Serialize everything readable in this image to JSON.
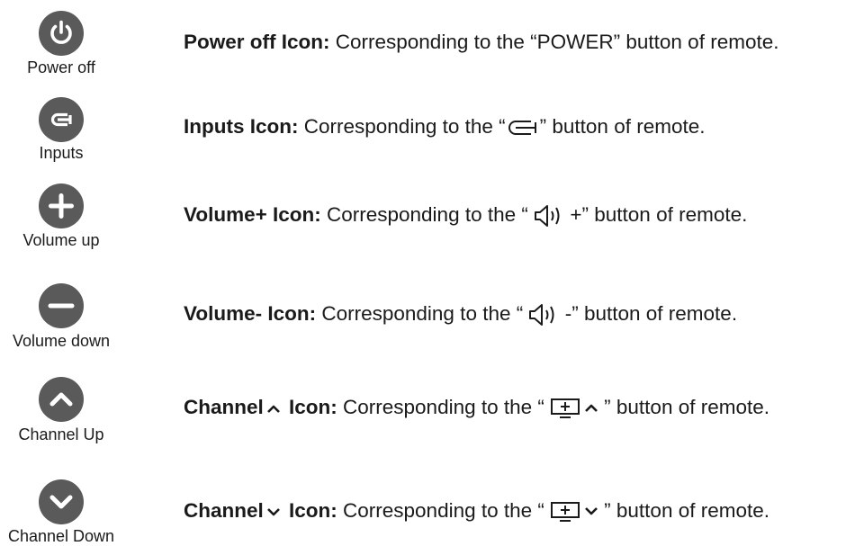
{
  "items": [
    {
      "caption": "Power off",
      "icon": "power-icon",
      "title": "Power off Icon:",
      "text_before": " Corresponding to the “POWER” button of remote."
    },
    {
      "caption": "Inputs",
      "icon": "inputs-icon",
      "title": "Inputs Icon:",
      "text_before": " Corresponding to the “",
      "remote_symbol": "input-source-symbol",
      "text_after": "” button of remote."
    },
    {
      "caption": "Volume up",
      "icon": "plus-icon",
      "title": "Volume+ Icon:",
      "text_before": " Corresponding to the “ ",
      "remote_symbol": "speaker-symbol",
      "text_after": " +” button of remote."
    },
    {
      "caption": "Volume down",
      "icon": "minus-icon",
      "title": "Volume- Icon:",
      "text_before": " Corresponding to the “ ",
      "remote_symbol": "speaker-symbol",
      "text_after": " -” button of remote."
    },
    {
      "caption": "Channel Up",
      "icon": "chevron-up-icon",
      "title_a": "Channel",
      "title_b": " Icon:",
      "text_before": " Corresponding to the “ ",
      "remote_symbol": "channel-up-symbol",
      "text_after": "” button of remote."
    },
    {
      "caption": "Channel Down",
      "icon": "chevron-down-icon",
      "title_a": "Channel",
      "title_b": " Icon:",
      "text_before": " Corresponding to the “ ",
      "remote_symbol": "channel-down-symbol",
      "text_after": "” button of remote."
    }
  ],
  "colors": {
    "icon_bg": "#5a5a5a",
    "icon_fg": "#ffffff",
    "text": "#1a1a1a"
  }
}
